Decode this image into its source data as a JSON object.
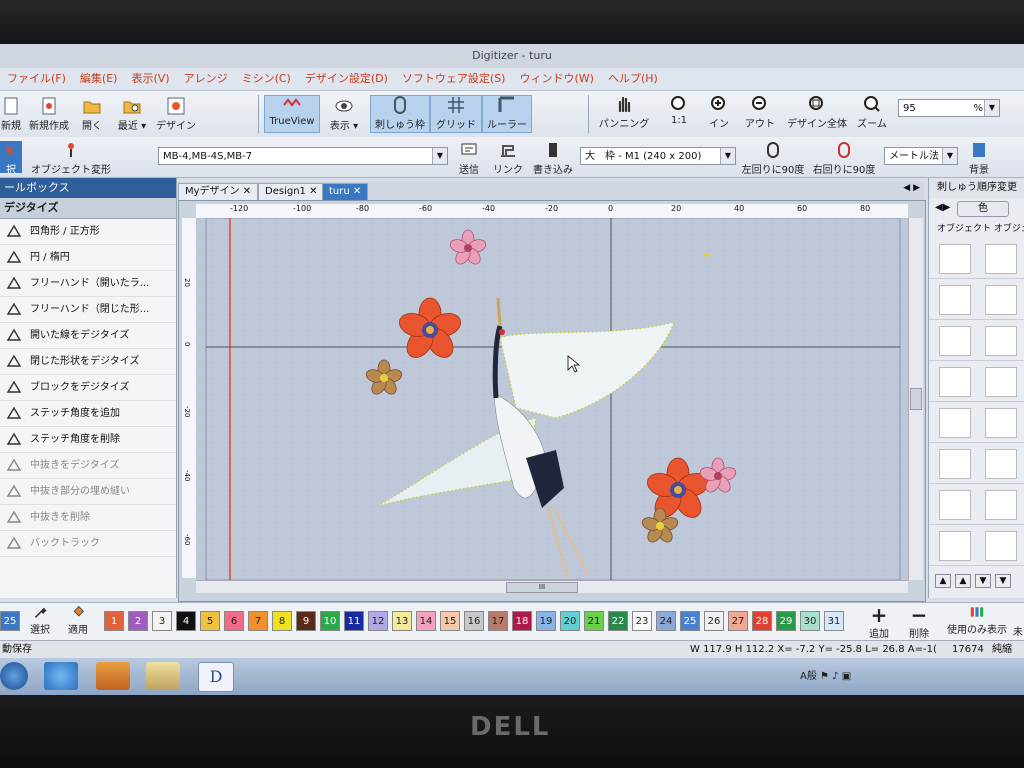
{
  "window": {
    "title": "Digitizer - turu"
  },
  "menu": [
    {
      "label": "ファイル(F)"
    },
    {
      "label": "編集(E)"
    },
    {
      "label": "表示(V)"
    },
    {
      "label": "アレンジ"
    },
    {
      "label": "ミシン(C)"
    },
    {
      "label": "デザイン設定(D)"
    },
    {
      "label": "ソフトウェア設定(S)"
    },
    {
      "label": "ウィンドウ(W)"
    },
    {
      "label": "ヘルプ(H)"
    }
  ],
  "toolbar1": {
    "new_label": "新規",
    "new_create_label": "新規作成",
    "open_label": "開く",
    "recent_label": "最近",
    "design_label": "デザイン",
    "trueview_label": "TrueView",
    "display_label": "表示",
    "hoop_label": "刺しゅう枠",
    "grid_label": "グリッド",
    "ruler_label": "ルーラー",
    "pan_label": "パンニング",
    "one_label": "1:1",
    "zoom_in_label": "イン",
    "zoom_out_label": "アウト",
    "fit_all_label": "デザイン全体",
    "zoom_label": "ズーム",
    "zoom_value": "95",
    "zoom_unit": "%"
  },
  "toolbar2": {
    "select_label": "択",
    "object_transform_label": "オブジェクト変形",
    "machine_value": "MB-4,MB-4S,MB-7",
    "send_label": "送信",
    "link_label": "リンク",
    "write_label": "書き込み",
    "hoop_value": "大　枠 - M1 (240 x 200)",
    "rotate_left_label": "左回りに90度",
    "rotate_right_label": "右回りに90度",
    "unit_value": "メートル法",
    "background_label": "背景"
  },
  "toolbox": {
    "header": "ールボックス",
    "section": "デジタイズ",
    "items": [
      {
        "label": "四角形 / 正方形",
        "dim": false
      },
      {
        "label": "円 / 楕円",
        "dim": false
      },
      {
        "label": "フリーハンド（開いたラ...",
        "dim": false
      },
      {
        "label": "フリーハンド（閉じた形...",
        "dim": false
      },
      {
        "label": "開いた線をデジタイズ",
        "dim": false
      },
      {
        "label": "閉じた形状をデジタイズ",
        "dim": false
      },
      {
        "label": "ブロックをデジタイズ",
        "dim": false
      },
      {
        "label": "ステッチ角度を追加",
        "dim": false
      },
      {
        "label": "ステッチ角度を削除",
        "dim": false
      },
      {
        "label": "中抜きをデジタイズ",
        "dim": true
      },
      {
        "label": "中抜き部分の埋め縫い",
        "dim": true
      },
      {
        "label": "中抜きを削除",
        "dim": true
      },
      {
        "label": "バックトラック",
        "dim": true
      }
    ]
  },
  "tabs": [
    {
      "label": "Myデザイン"
    },
    {
      "label": "Design1"
    },
    {
      "label": "turu"
    }
  ],
  "ruler": {
    "h_ticks": [
      "-120",
      "-100",
      "-80",
      "-60",
      "-40",
      "-20",
      "0",
      "20",
      "40",
      "60",
      "80"
    ],
    "v_ticks": [
      "20",
      "0",
      "-20",
      "-40",
      "-60"
    ]
  },
  "hscroll_label": "III",
  "right_panel": {
    "title": "刺しゅう順序変更",
    "color_btn": "色",
    "col1": "オブジェクト",
    "col2": "オブジェク"
  },
  "palette": {
    "swatches": [
      {
        "n": "1",
        "c": "#e0623a"
      },
      {
        "n": "2",
        "c": "#a05cc0"
      },
      {
        "n": "3",
        "c": "#f2f2f2"
      },
      {
        "n": "4",
        "c": "#111111"
      },
      {
        "n": "5",
        "c": "#f0c040"
      },
      {
        "n": "6",
        "c": "#f06a8a"
      },
      {
        "n": "7",
        "c": "#f0902a"
      },
      {
        "n": "8",
        "c": "#f0e020"
      },
      {
        "n": "9",
        "c": "#5a2a1a"
      },
      {
        "n": "10",
        "c": "#2aa84a"
      },
      {
        "n": "11",
        "c": "#1a2aa0"
      },
      {
        "n": "12",
        "c": "#b0a8e8"
      },
      {
        "n": "13",
        "c": "#f4ea9a"
      },
      {
        "n": "14",
        "c": "#f4a0c0"
      },
      {
        "n": "15",
        "c": "#f4c8a8"
      },
      {
        "n": "16",
        "c": "#c8c8c8"
      },
      {
        "n": "17",
        "c": "#b87a6a"
      },
      {
        "n": "18",
        "c": "#b01a4a"
      },
      {
        "n": "19",
        "c": "#8ab4e8"
      },
      {
        "n": "20",
        "c": "#60d0d0"
      },
      {
        "n": "21",
        "c": "#6ad04a"
      },
      {
        "n": "22",
        "c": "#2a8a4a"
      },
      {
        "n": "23",
        "c": "#f8f8f8"
      },
      {
        "n": "24",
        "c": "#8aa8d8"
      },
      {
        "n": "25",
        "c": "#4a80d0"
      },
      {
        "n": "26",
        "c": "#f0f0f0"
      },
      {
        "n": "27",
        "c": "#f0a890"
      },
      {
        "n": "28",
        "c": "#e04030"
      },
      {
        "n": "29",
        "c": "#2a9a4a"
      },
      {
        "n": "30",
        "c": "#a8e0d0"
      },
      {
        "n": "31",
        "c": "#d8e8f8"
      }
    ],
    "select_label": "選択",
    "apply_label": "適用",
    "add_label": "追加",
    "delete_label": "削除",
    "used_only_label": "使用のみ表示",
    "extra_label": "未",
    "current_label": "25"
  },
  "status": {
    "left": "動保存",
    "coords": "W 117.9 H 112.2  X=  -7.2 Y=  -25.8 L=   26.8 A=-1(",
    "count": "17674",
    "mode": "純縮"
  },
  "taskbar": {
    "tray_text": "A般",
    "doc_letter": "D"
  },
  "brand": "DELL",
  "colors": {
    "accent": "#3a78c4",
    "flower_orange": "#e8552e",
    "flower_pink": "#e8a0b8",
    "menu_text": "#c83c1a"
  }
}
